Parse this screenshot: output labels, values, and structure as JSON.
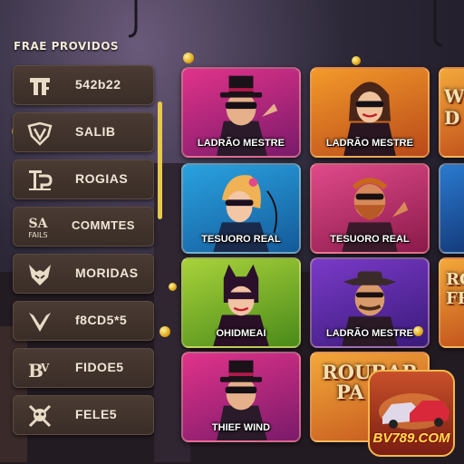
{
  "sidebar": {
    "title": "FRAE PROVIDOS",
    "providers": [
      {
        "label": "542b22",
        "icon": "tf-logo-icon"
      },
      {
        "label": "SALIB",
        "icon": "v-shield-icon"
      },
      {
        "label": "ROGIAS",
        "icon": "tp-logo-icon"
      },
      {
        "label": "COMMTES",
        "icon": "sa-fails-logo-icon",
        "logo_text": "SA FAILS"
      },
      {
        "label": "MORIDAS",
        "icon": "fox-head-icon"
      },
      {
        "label": "f8CD5*5",
        "icon": "v-wing-icon"
      },
      {
        "label": "FIDOE5",
        "icon": "bv-logo-icon"
      },
      {
        "label": "FELE5",
        "icon": "skull-icon"
      }
    ]
  },
  "games": [
    {
      "name": "LADRÃO MESTRE",
      "theme": "pink-magenta"
    },
    {
      "name": "LADRÃO MESTRE",
      "theme": "orange"
    },
    {
      "banner": "W D",
      "theme": "orange-partial"
    },
    {
      "name": "TESUORO REAL",
      "theme": "blue"
    },
    {
      "name": "TESUORO REAL",
      "theme": "pink"
    },
    {
      "theme": "blue-partial"
    },
    {
      "name": "OHIDMEAI",
      "theme": "green"
    },
    {
      "name": "LADRÃO MESTRE",
      "theme": "purple"
    },
    {
      "banner": "RO FRE",
      "theme": "orange-partial"
    },
    {
      "name": "THIEF WIND",
      "theme": "pink-magenta"
    },
    {
      "banner": "ROUBAR PA GU",
      "theme": "orange"
    }
  ],
  "watermark": {
    "text": "BV789.COM"
  },
  "colors": {
    "accent": "#e8c949",
    "panel": "#3e302a",
    "text": "#f0e6d6"
  }
}
